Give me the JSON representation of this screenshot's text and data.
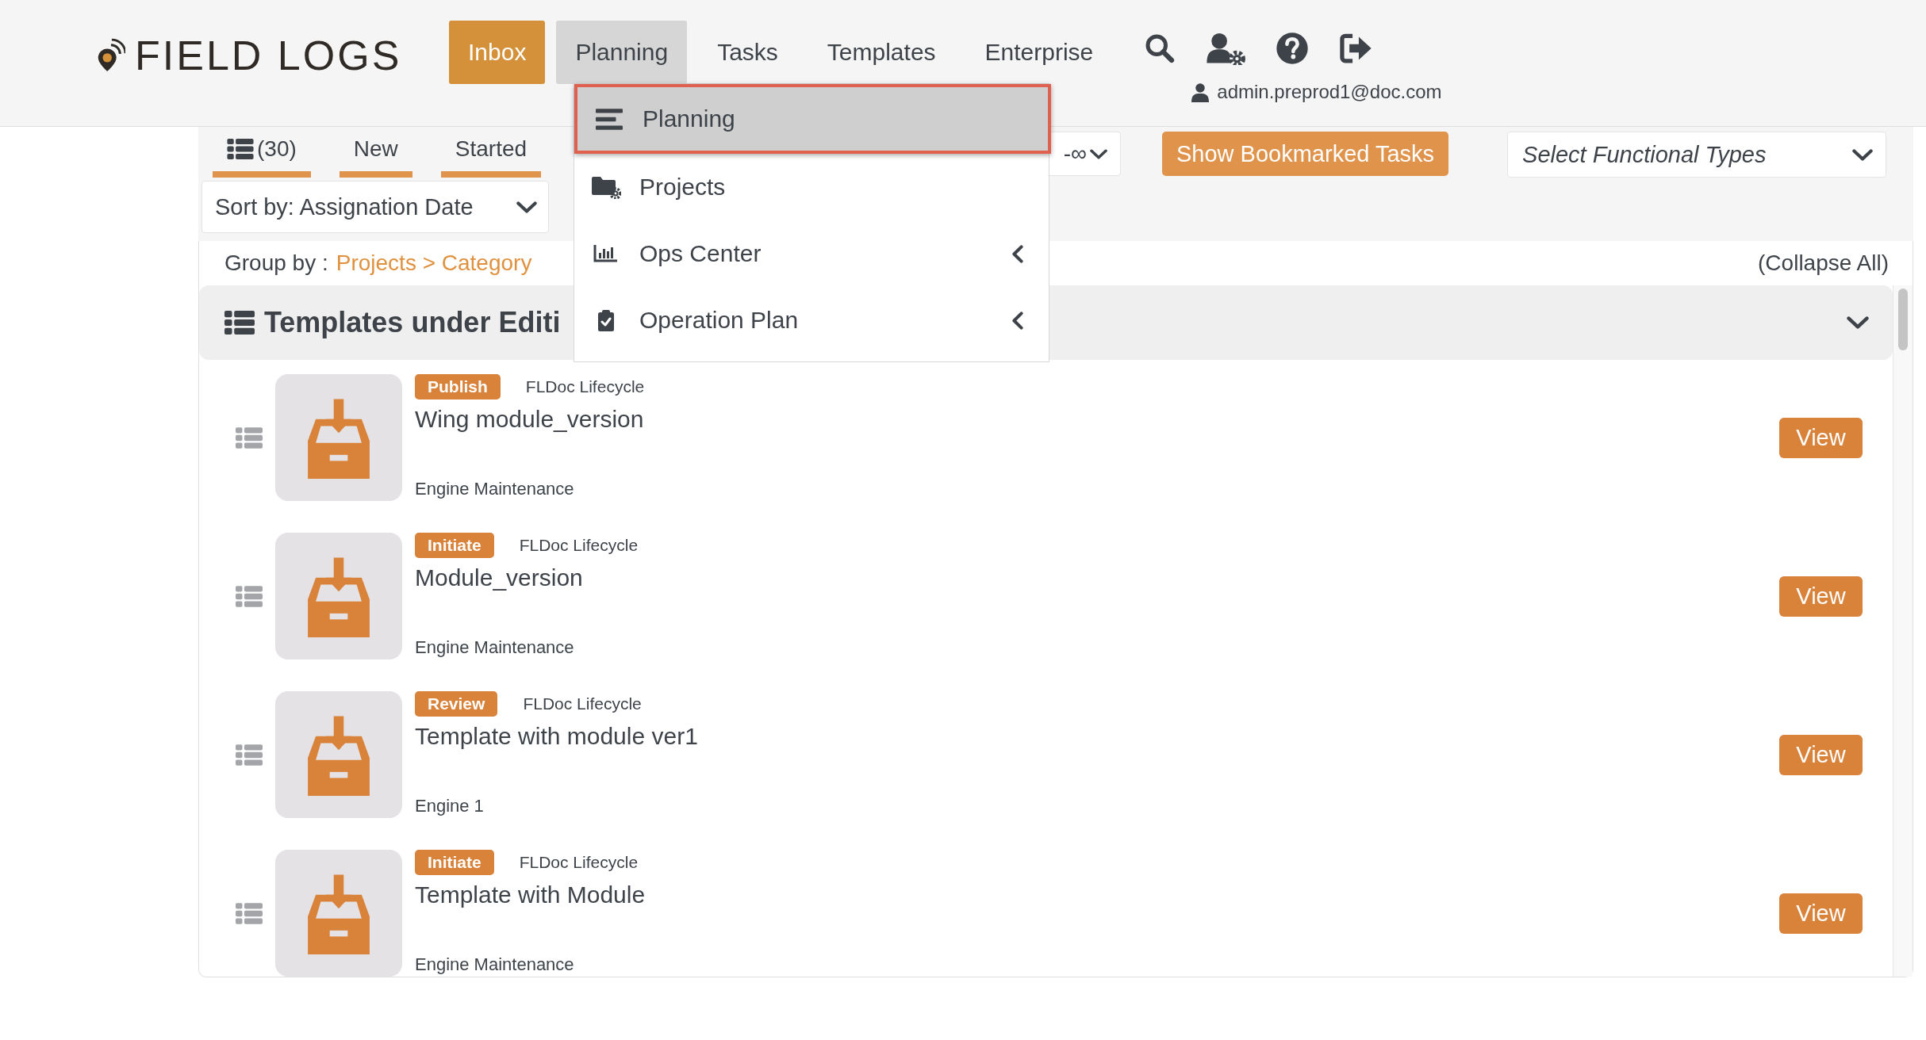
{
  "header": {
    "logo": "FIELD LOGS",
    "user": "admin.preprod1@doc.com",
    "nav": [
      {
        "label": "Inbox",
        "selected": true,
        "expanded": false
      },
      {
        "label": "Planning",
        "selected": false,
        "expanded": true
      },
      {
        "label": "Tasks",
        "selected": false,
        "expanded": false
      },
      {
        "label": "Templates",
        "selected": false,
        "expanded": false
      },
      {
        "label": "Enterprise",
        "selected": false,
        "expanded": false
      }
    ]
  },
  "planning_menu": [
    {
      "label": "Planning",
      "selected": true,
      "submenu": false
    },
    {
      "label": "Projects",
      "selected": false,
      "submenu": false
    },
    {
      "label": "Ops Center",
      "selected": false,
      "submenu": true
    },
    {
      "label": "Operation Plan",
      "selected": false,
      "submenu": true
    }
  ],
  "toolbar": {
    "tabs": [
      "(30)",
      "New",
      "Started"
    ],
    "date_range": "-∞",
    "bookmark_button": "Show Bookmarked Tasks",
    "functional_types": {
      "placeholder": "Select Functional Types"
    },
    "sort": "Sort by: Assignation Date"
  },
  "group_by": {
    "label": "Group by :",
    "value": "Projects > Category"
  },
  "collapse_all": "(Collapse All)",
  "section": {
    "title": "Templates under Editi"
  },
  "items": [
    {
      "badge": "Publish",
      "lifecycle": "FLDoc Lifecycle",
      "title": "Wing module_version",
      "category": "Engine Maintenance",
      "action": "View"
    },
    {
      "badge": "Initiate",
      "lifecycle": "FLDoc Lifecycle",
      "title": "Module_version",
      "category": "Engine Maintenance",
      "action": "View"
    },
    {
      "badge": "Review",
      "lifecycle": "FLDoc Lifecycle",
      "title": "Template with module ver1",
      "category": "Engine 1",
      "action": "View"
    },
    {
      "badge": "Initiate",
      "lifecycle": "FLDoc Lifecycle",
      "title": "Template with Module",
      "category": "Engine Maintenance",
      "action": "View"
    }
  ]
}
